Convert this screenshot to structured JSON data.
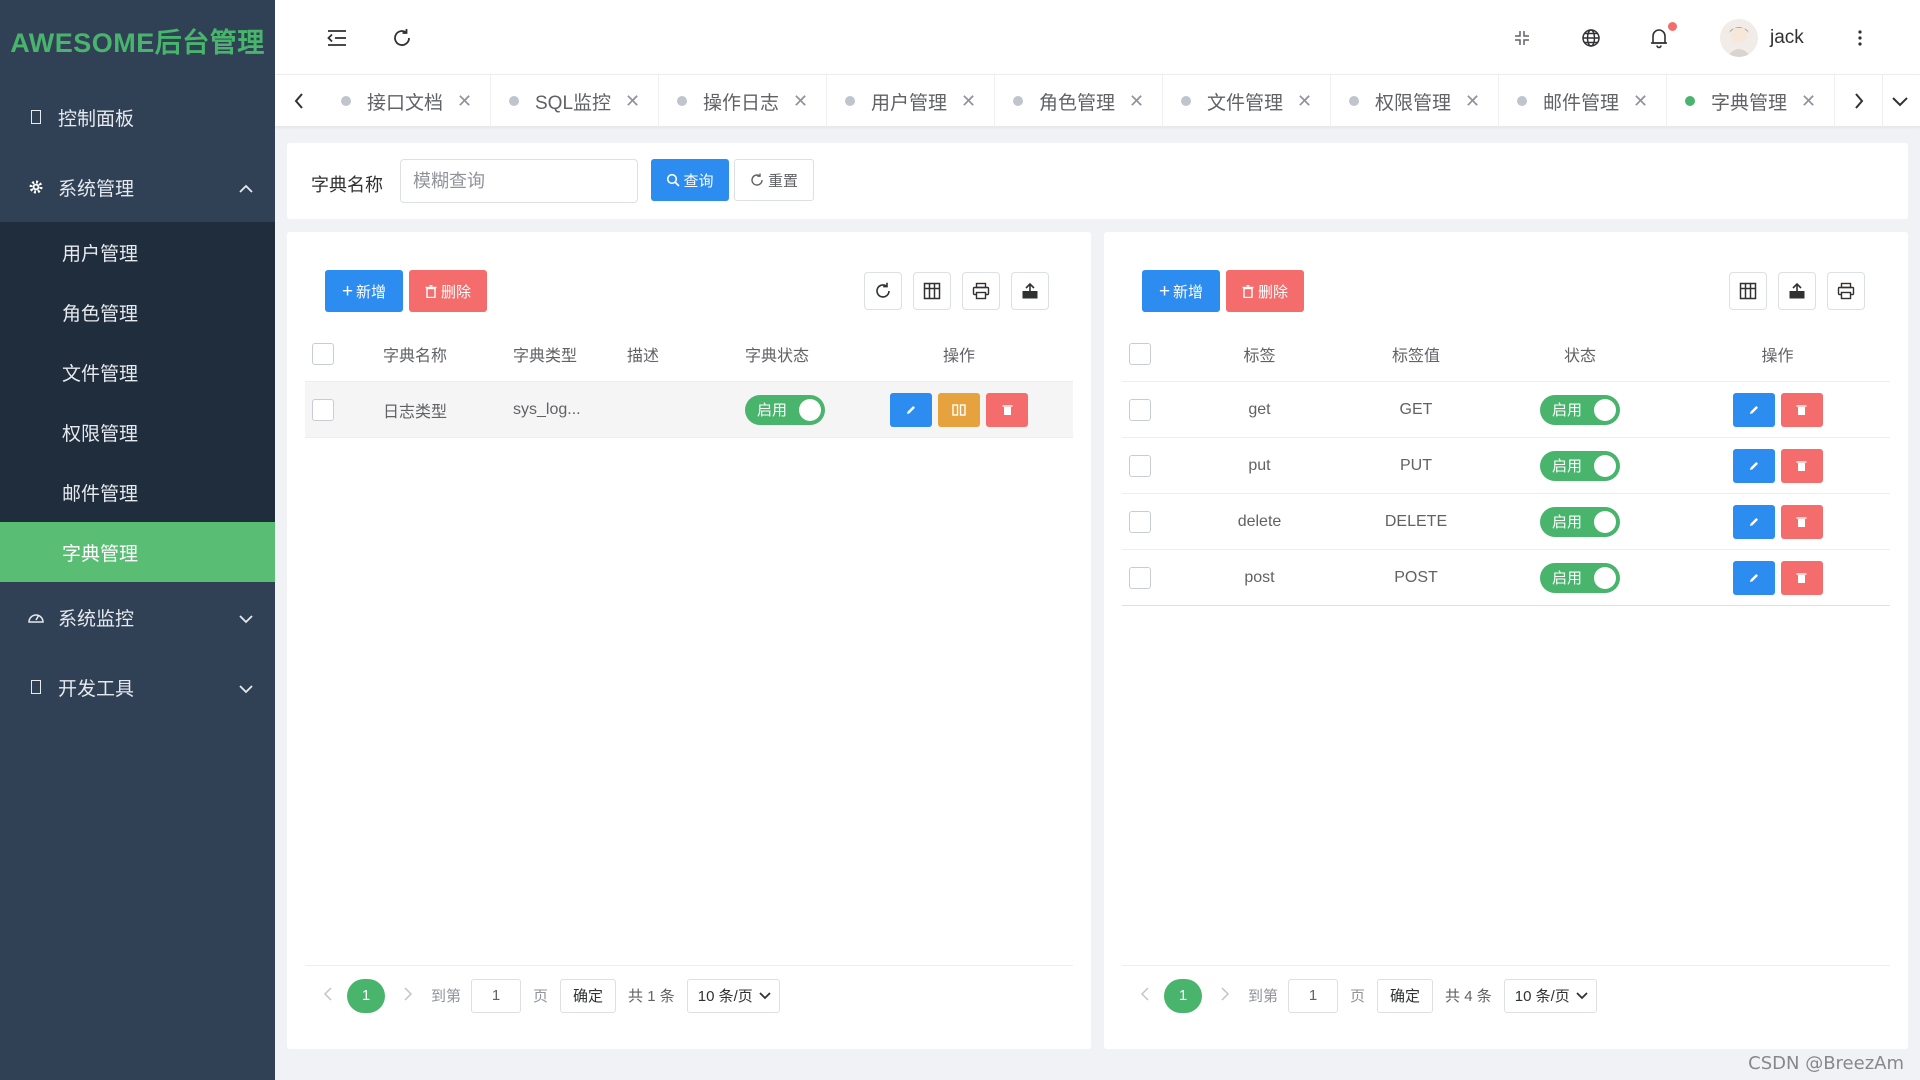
{
  "sidebar": {
    "logo": "AWESOME后台管理",
    "menu": [
      {
        "label": "控制面板"
      },
      {
        "label": "系统管理"
      },
      {
        "label": "系统监控"
      },
      {
        "label": "开发工具"
      }
    ],
    "submenu": [
      "用户管理",
      "角色管理",
      "文件管理",
      "权限管理",
      "邮件管理",
      "字典管理"
    ],
    "active_item": "字典管理"
  },
  "topbar": {
    "username": "jack",
    "notification_dot_color": "#f56c6c"
  },
  "tags": [
    "接口文档",
    "SQL监控",
    "操作日志",
    "用户管理",
    "角色管理",
    "文件管理",
    "权限管理",
    "邮件管理",
    "字典管理"
  ],
  "active_tag": "字典管理",
  "search": {
    "label": "字典名称",
    "placeholder": "模糊查询",
    "query_label": "查询",
    "reset_label": "重置"
  },
  "left_panel": {
    "add_label": "新增",
    "delete_label": "删除",
    "columns": [
      "字典名称",
      "字典类型",
      "描述",
      "字典状态",
      "操作"
    ],
    "rows": [
      {
        "name": "日志类型",
        "type": "sys_log...",
        "desc": "",
        "status": "启用"
      }
    ],
    "pager": {
      "page": "1",
      "goto_label": "到第",
      "goto_value": "1",
      "page_unit": "页",
      "confirm_label": "确定",
      "total_label": "共 1 条",
      "size_label": "10 条/页"
    }
  },
  "right_panel": {
    "add_label": "新增",
    "delete_label": "删除",
    "columns": [
      "标签",
      "标签值",
      "状态",
      "操作"
    ],
    "rows": [
      {
        "label": "get",
        "value": "GET",
        "status": "启用"
      },
      {
        "label": "put",
        "value": "PUT",
        "status": "启用"
      },
      {
        "label": "delete",
        "value": "DELETE",
        "status": "启用"
      },
      {
        "label": "post",
        "value": "POST",
        "status": "启用"
      }
    ],
    "pager": {
      "page": "1",
      "goto_label": "到第",
      "goto_value": "1",
      "page_unit": "页",
      "confirm_label": "确定",
      "total_label": "共 4 条",
      "size_label": "10 条/页"
    }
  },
  "colors": {
    "sidebar_bg": "#304156",
    "accent_green": "#49b46c",
    "primary_blue": "#2d8cf0",
    "danger_red": "#f56c6c",
    "warning_orange": "#e6a23c"
  },
  "watermark": "CSDN @BreezAm"
}
